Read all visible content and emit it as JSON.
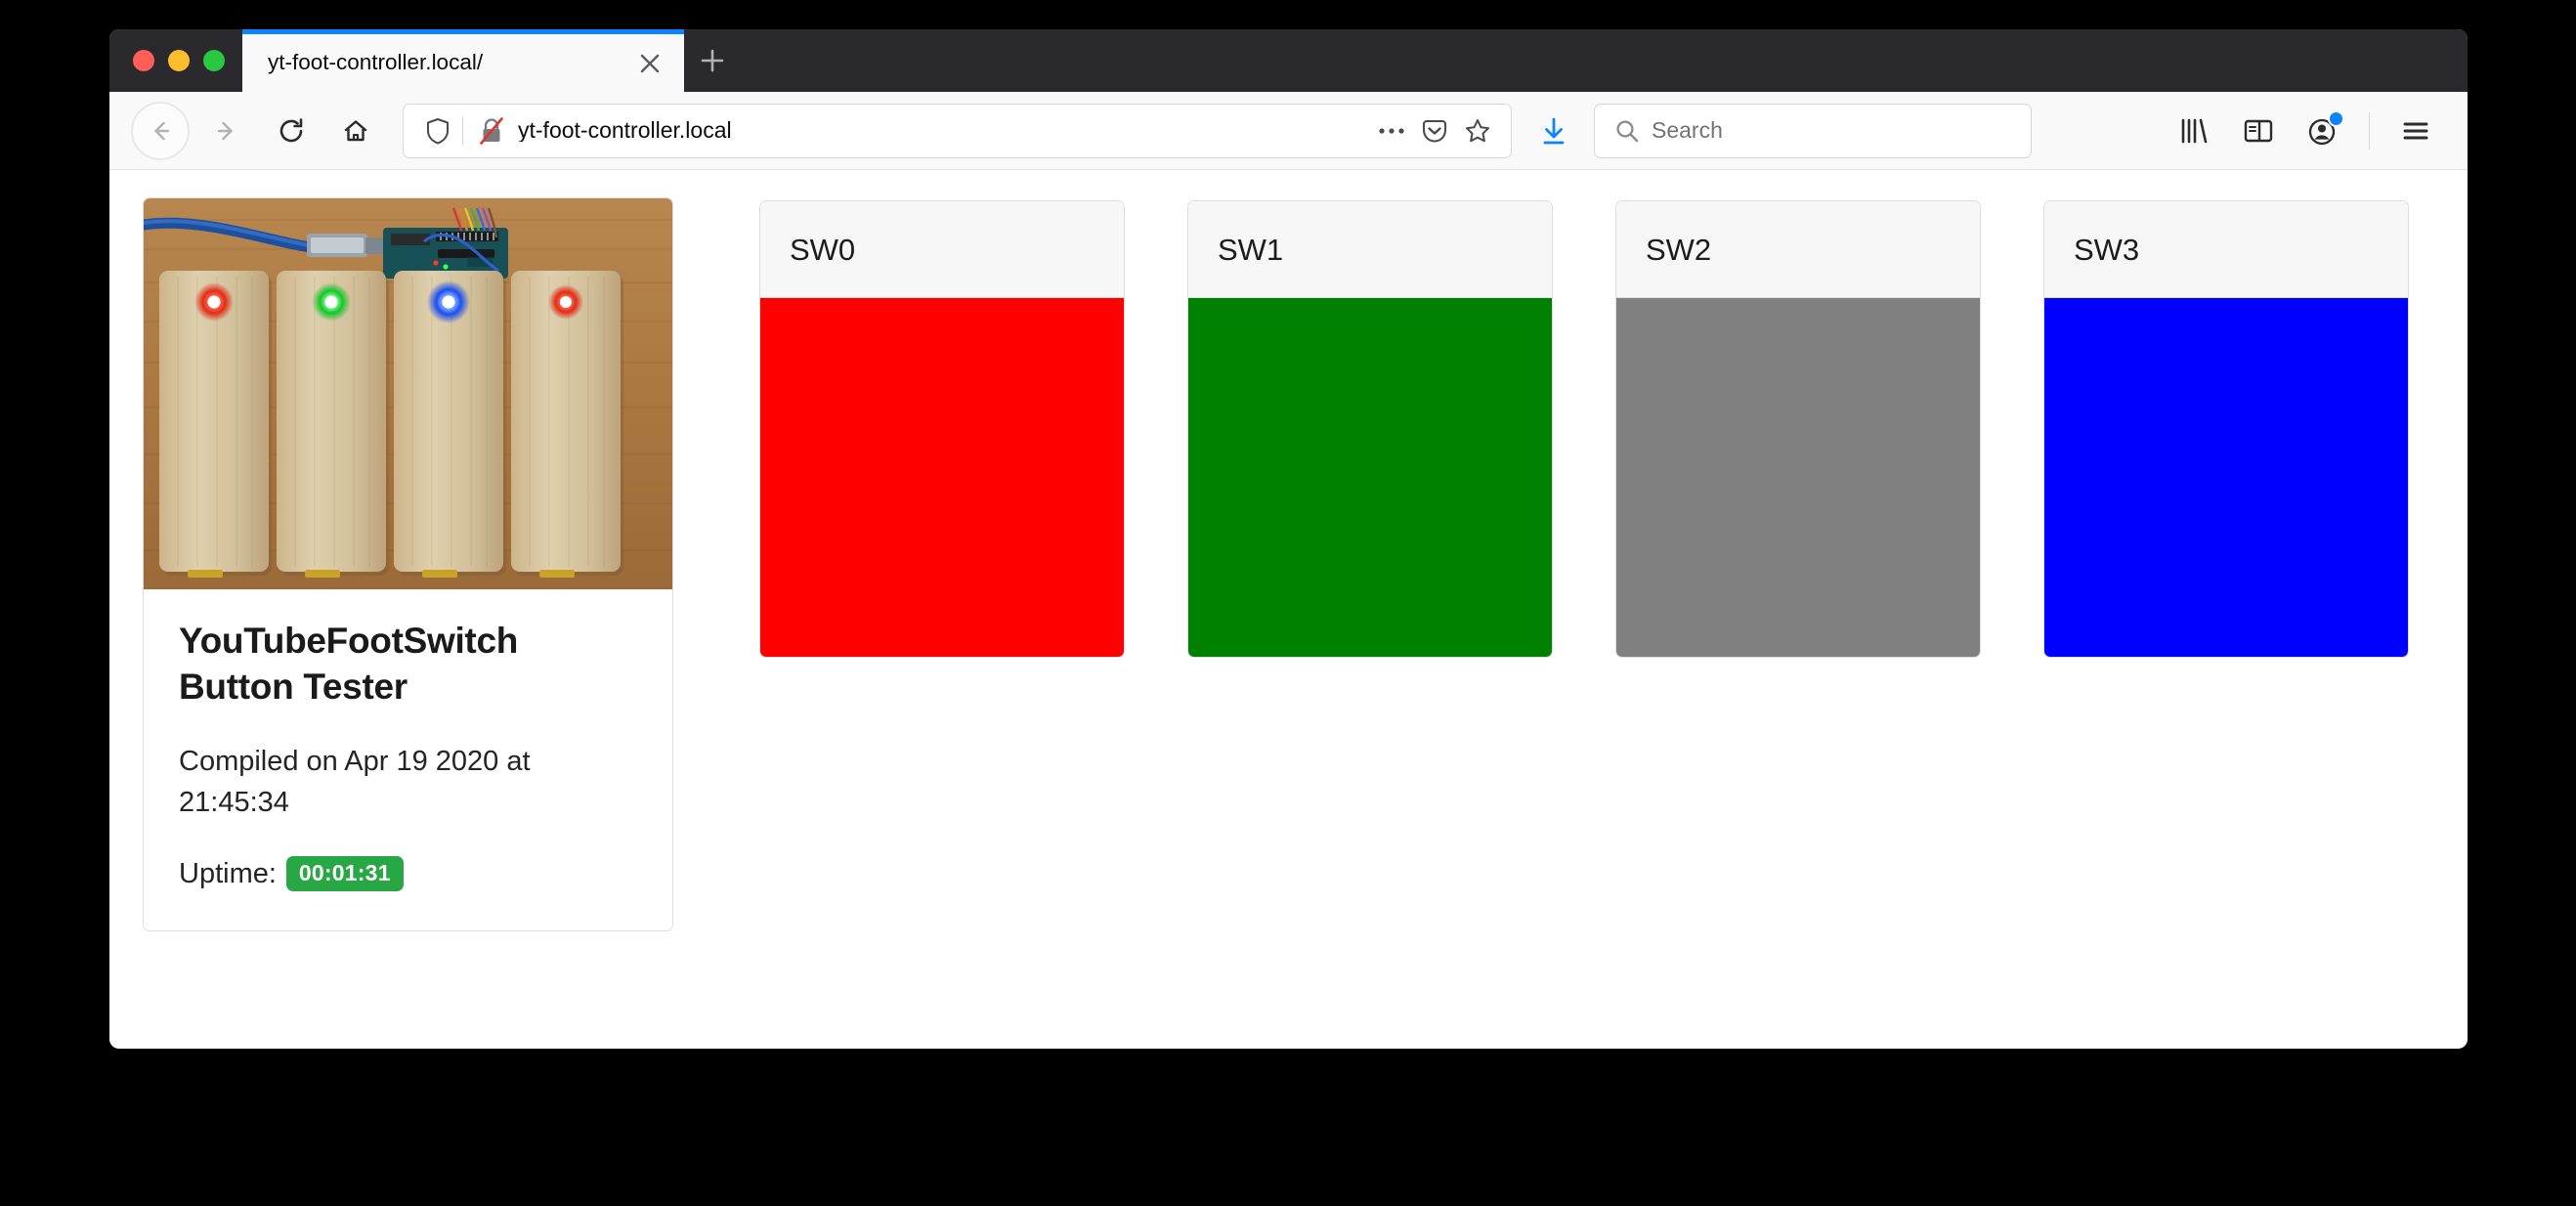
{
  "browser": {
    "traffic_lights": [
      "close",
      "minimize",
      "maximize"
    ],
    "tab": {
      "title": "yt-foot-controller.local/",
      "close_icon": "close-icon",
      "accent_color": "#0a84ff"
    },
    "new_tab_icon": "plus-icon",
    "nav": {
      "back_icon": "back-arrow-icon",
      "forward_icon": "forward-arrow-icon",
      "reload_icon": "reload-icon",
      "home_icon": "home-icon"
    },
    "url_bar": {
      "shield_icon": "shield-icon",
      "insecure_icon": "insecure-connection-icon",
      "url": "yt-foot-controller.local",
      "page_actions_icon": "ellipsis-icon",
      "pocket_icon": "pocket-icon",
      "bookmark_icon": "star-icon"
    },
    "download_icon": "download-arrow-icon",
    "download_color": "#0a84ff",
    "search": {
      "icon": "search-icon",
      "placeholder": "Search",
      "value": ""
    },
    "right_icons": {
      "library": "library-icon",
      "sidebar": "sidebar-icon",
      "account": "account-icon",
      "account_badge_color": "#0a84ff",
      "menu": "hamburger-menu-icon"
    }
  },
  "page": {
    "info_card": {
      "photo_alt": "youtube-foot-switch-device-photo",
      "title": "YouTubeFootSwitch Button Tester",
      "compiled": "Compiled on Apr 19 2020 at 21:45:34",
      "uptime_label": "Uptime:",
      "uptime_value": "00:01:31",
      "uptime_badge_color": "#28a745"
    },
    "switches": [
      {
        "label": "SW0",
        "color": "#ff0000",
        "state": "red"
      },
      {
        "label": "SW1",
        "color": "#008000",
        "state": "green"
      },
      {
        "label": "SW2",
        "color": "#808080",
        "state": "gray"
      },
      {
        "label": "SW3",
        "color": "#0000ff",
        "state": "blue"
      }
    ]
  }
}
